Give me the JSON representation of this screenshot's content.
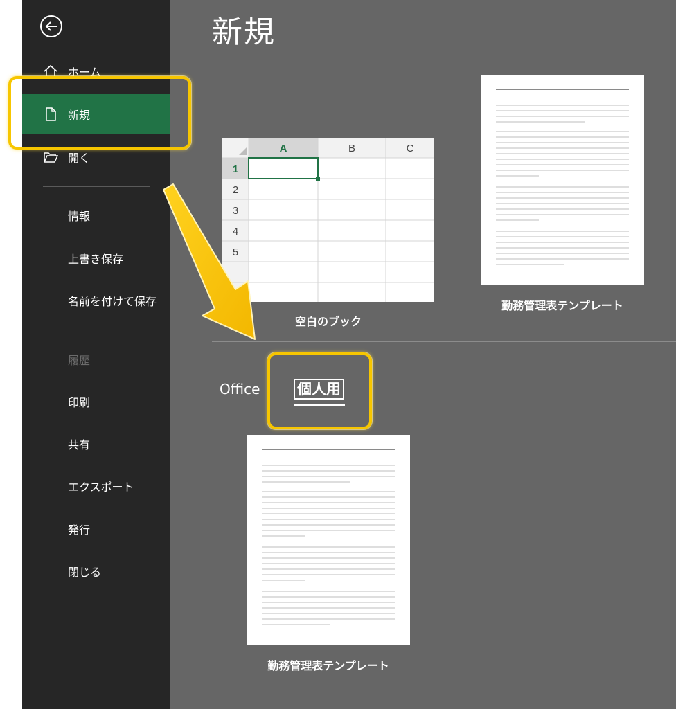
{
  "sidebar": {
    "icons": {
      "back": "back-arrow-icon",
      "home": "home-icon",
      "new": "new-document-icon",
      "open": "open-folder-icon"
    },
    "items": [
      {
        "id": "home",
        "label": "ホーム"
      },
      {
        "id": "new",
        "label": "新規"
      },
      {
        "id": "open",
        "label": "開く"
      }
    ],
    "sub_items": [
      {
        "id": "info",
        "label": "情報"
      },
      {
        "id": "save",
        "label": "上書き保存"
      },
      {
        "id": "save-as",
        "label": "名前を付けて保存"
      },
      {
        "id": "history",
        "label": "履歴"
      },
      {
        "id": "print",
        "label": "印刷"
      },
      {
        "id": "share",
        "label": "共有"
      },
      {
        "id": "export",
        "label": "エクスポート"
      },
      {
        "id": "publish",
        "label": "発行"
      },
      {
        "id": "close",
        "label": "閉じる"
      }
    ]
  },
  "main": {
    "title": "新規",
    "templates": [
      {
        "label": "空白のブック",
        "kind": "blank-workbook"
      },
      {
        "label": "勤務管理表テンプレート",
        "kind": "document"
      }
    ],
    "blank_grid": {
      "columns": [
        "A",
        "B",
        "C"
      ],
      "rows": [
        "1",
        "2",
        "3",
        "4",
        "5"
      ]
    },
    "categories": [
      {
        "label": "Office"
      },
      {
        "label": "個人用"
      }
    ],
    "personal_templates": [
      {
        "label": "勤務管理表テンプレート"
      }
    ]
  },
  "colors": {
    "sidebar_bg": "#262626",
    "active_item": "#217346",
    "main_bg": "#666666",
    "highlight": "#f7c600",
    "excel_green": "#217346"
  }
}
